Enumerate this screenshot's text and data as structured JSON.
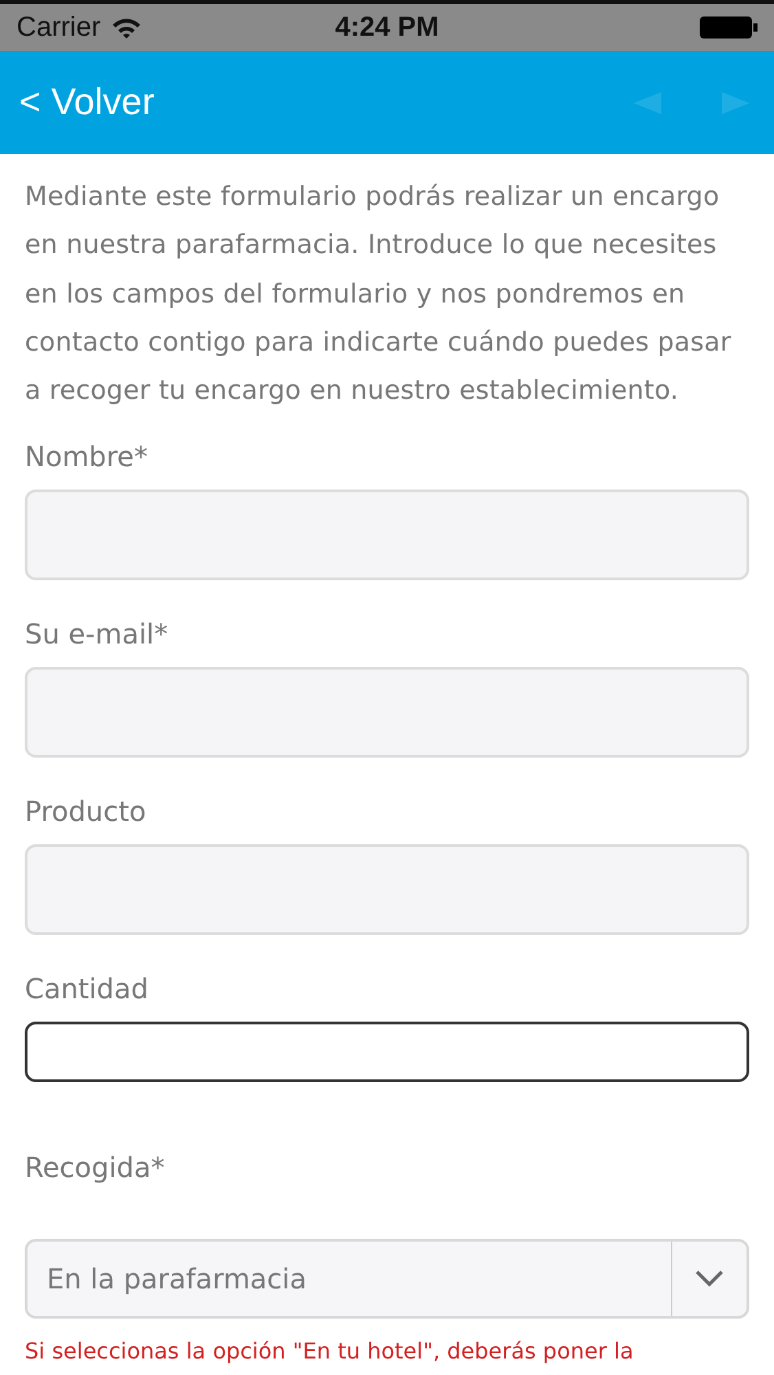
{
  "status_bar": {
    "carrier": "Carrier",
    "time": "4:24 PM"
  },
  "nav_bar": {
    "back": "< Volver",
    "prev_disabled": true,
    "next_disabled": true
  },
  "intro": "Mediante este formulario podrás realizar un encargo en nuestra parafarmacia. Introduce lo que necesites en los campos del formulario y nos pondremos en contacto contigo para indicarte cuándo puedes pasar a recoger tu encargo en nuestro establecimiento.",
  "fields": [
    {
      "label": "Nombre*",
      "focused": false
    },
    {
      "label": "Su e-mail*",
      "focused": false
    },
    {
      "label": "Producto",
      "focused": false
    },
    {
      "label": "Cantidad",
      "focused": true
    }
  ],
  "pickup": {
    "label": "Recogida*",
    "value": "En la parafarmacia"
  },
  "note": "Si seleccionas la opción \"En tu hotel\", deberás poner la"
}
